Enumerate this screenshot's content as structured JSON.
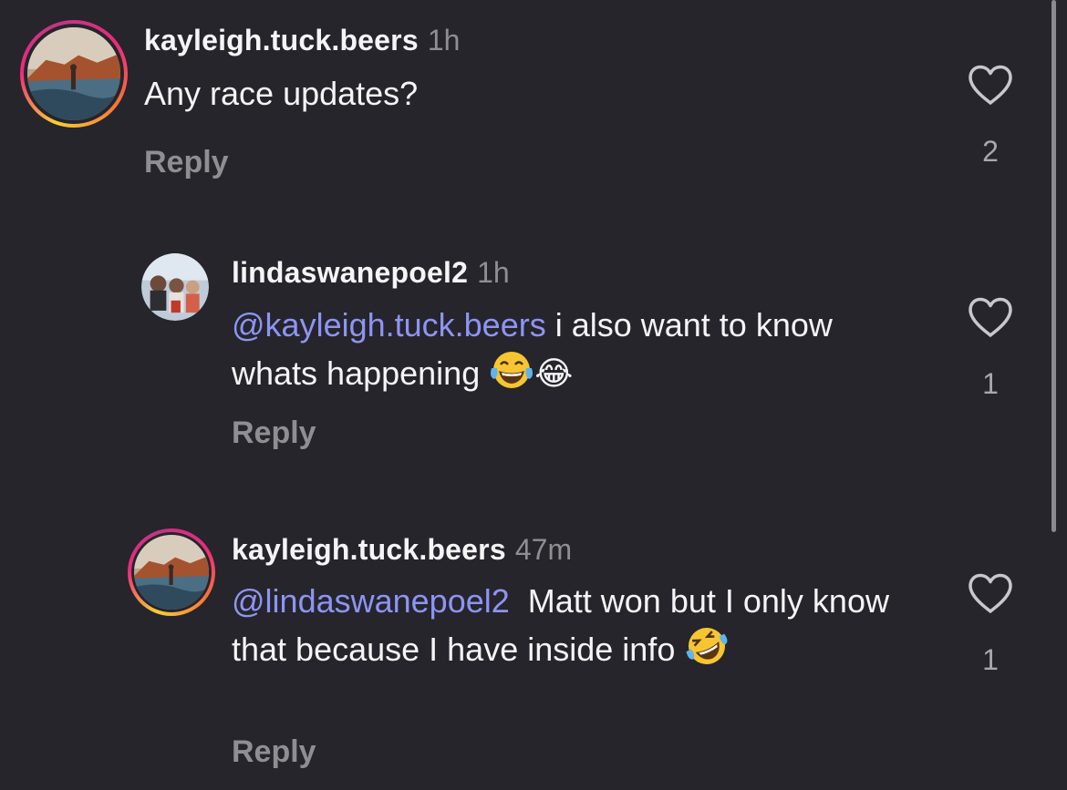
{
  "comments": [
    {
      "username": "kayleigh.tuck.beers",
      "time": "1h",
      "mention": "",
      "text": "Any race updates?",
      "reply_label": "Reply",
      "like_count": "2",
      "avatar": "kayleigh-avatar",
      "has_story_ring": true
    },
    {
      "username": "lindaswanepoel2",
      "time": "1h",
      "mention": "@kayleigh.tuck.beers",
      "text": " i also want to know whats happening ",
      "emoji": "😂",
      "reply_label": "Reply",
      "like_count": "1",
      "avatar": "linda-avatar",
      "has_story_ring": false
    },
    {
      "username": "kayleigh.tuck.beers",
      "time": "47m",
      "mention": "@lindaswanepoel2",
      "text": "  Matt won but I only know that because I have inside info ",
      "emoji": "🤣",
      "reply_label": "Reply",
      "like_count": "1",
      "avatar": "kayleigh-avatar",
      "has_story_ring": true
    }
  ],
  "icons": {
    "like": "heart-outline-icon"
  },
  "colors": {
    "background": "#25252b",
    "mention": "#8e94f4",
    "secondary_text": "#8e8e93"
  }
}
